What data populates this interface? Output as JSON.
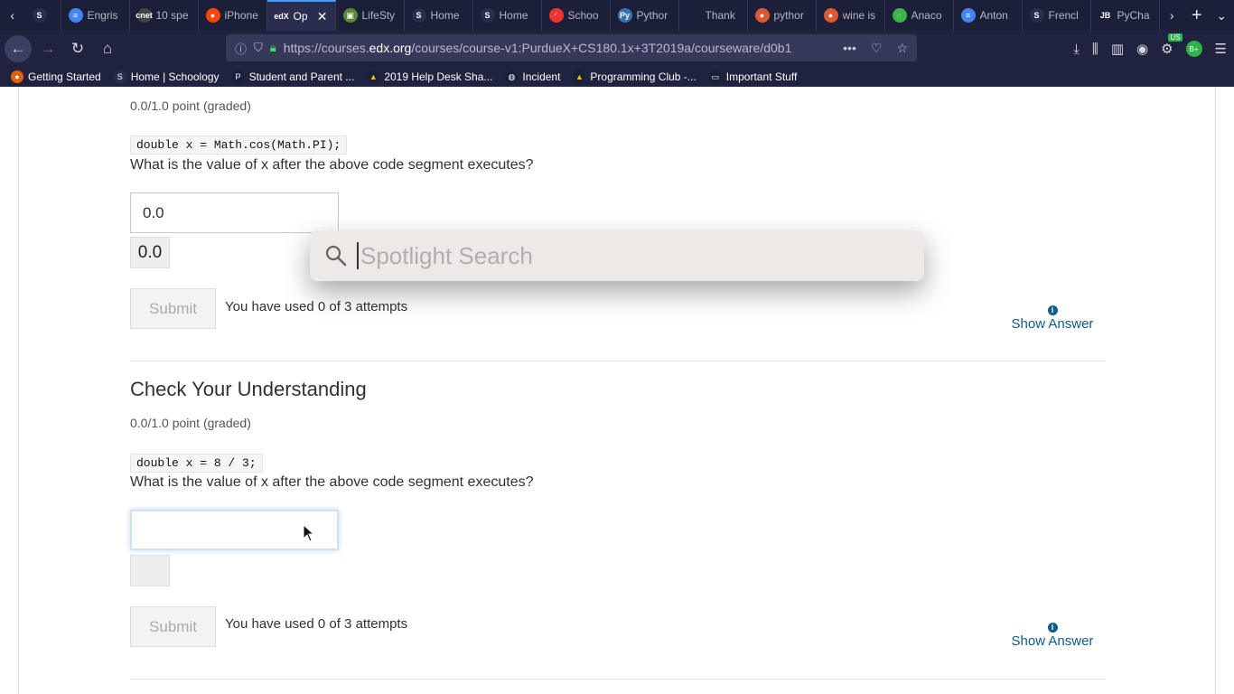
{
  "browser": {
    "tabs": [
      {
        "label": "",
        "fav_color": "#2a2d4e",
        "fav_glyph": "S"
      },
      {
        "label": "Engris",
        "fav_color": "#4285f4",
        "fav_glyph": "≡"
      },
      {
        "label": "10 spe",
        "fav_color": "#444",
        "fav_glyph": "cnet"
      },
      {
        "label": "iPhone",
        "fav_color": "#ff4500",
        "fav_glyph": "●"
      },
      {
        "label": "Op",
        "fav_color": "#2a2d4e",
        "fav_glyph": "edX",
        "active": true
      },
      {
        "label": "LifeSty",
        "fav_color": "#5a8a3a",
        "fav_glyph": "▣"
      },
      {
        "label": "Home",
        "fav_color": "#2a2d4e",
        "fav_glyph": "S"
      },
      {
        "label": "Home",
        "fav_color": "#2a2d4e",
        "fav_glyph": "S"
      },
      {
        "label": "Schoo",
        "fav_color": "#e33",
        "fav_glyph": "◜"
      },
      {
        "label": "Pythor",
        "fav_color": "#3a72b0",
        "fav_glyph": "Py"
      },
      {
        "label": "Thank",
        "fav_color": "#1c1f38",
        "fav_glyph": ""
      },
      {
        "label": "pythor",
        "fav_color": "#de5833",
        "fav_glyph": "●"
      },
      {
        "label": "wine is",
        "fav_color": "#de5833",
        "fav_glyph": "●"
      },
      {
        "label": "Anaco",
        "fav_color": "#3bb44a",
        "fav_glyph": "◌"
      },
      {
        "label": "Anton",
        "fav_color": "#4285f4",
        "fav_glyph": "≡"
      },
      {
        "label": "Frencl",
        "fav_color": "#2a2d4e",
        "fav_glyph": "S"
      },
      {
        "label": "PyCha",
        "fav_color": "#1c1f38",
        "fav_glyph": "JB"
      }
    ],
    "url_prefix": "https://courses.",
    "url_domain": "edx.org",
    "url_rest": "/courses/course-v1:PurdueX+CS180.1x+3T2019a/courseware/d0b1",
    "bookmarks": [
      {
        "label": "Getting Started",
        "icon": "firefox"
      },
      {
        "label": "Home | Schoology",
        "icon": "S"
      },
      {
        "label": "Student and Parent ...",
        "icon": "P"
      },
      {
        "label": "2019 Help Desk Sha...",
        "icon": "drive"
      },
      {
        "label": "Incident",
        "icon": "globe"
      },
      {
        "label": "Programming Club -...",
        "icon": "drive"
      },
      {
        "label": "Important Stuff",
        "icon": "folder"
      }
    ],
    "badge_us": "US",
    "badge_bplus": "B+"
  },
  "problem1": {
    "points": "0.0/1.0 point (graded)",
    "code": "double x = Math.cos(Math.PI);",
    "question": "What is the value of x after the above code segment executes?",
    "input_value": "0.0",
    "preview_value": "0.0",
    "submit_label": "Submit",
    "attempts_text": "You have used 0 of 3 attempts",
    "show_answer": "Show Answer"
  },
  "problem2": {
    "title": "Check Your Understanding",
    "points": "0.0/1.0 point (graded)",
    "code": "double x = 8 / 3;",
    "question": "What is the value of x after the above code segment executes?",
    "input_value": "",
    "preview_value": "",
    "submit_label": "Submit",
    "attempts_text": "You have used 0 of 3 attempts",
    "show_answer": "Show Answer"
  },
  "spotlight": {
    "placeholder": "Spotlight Search"
  }
}
